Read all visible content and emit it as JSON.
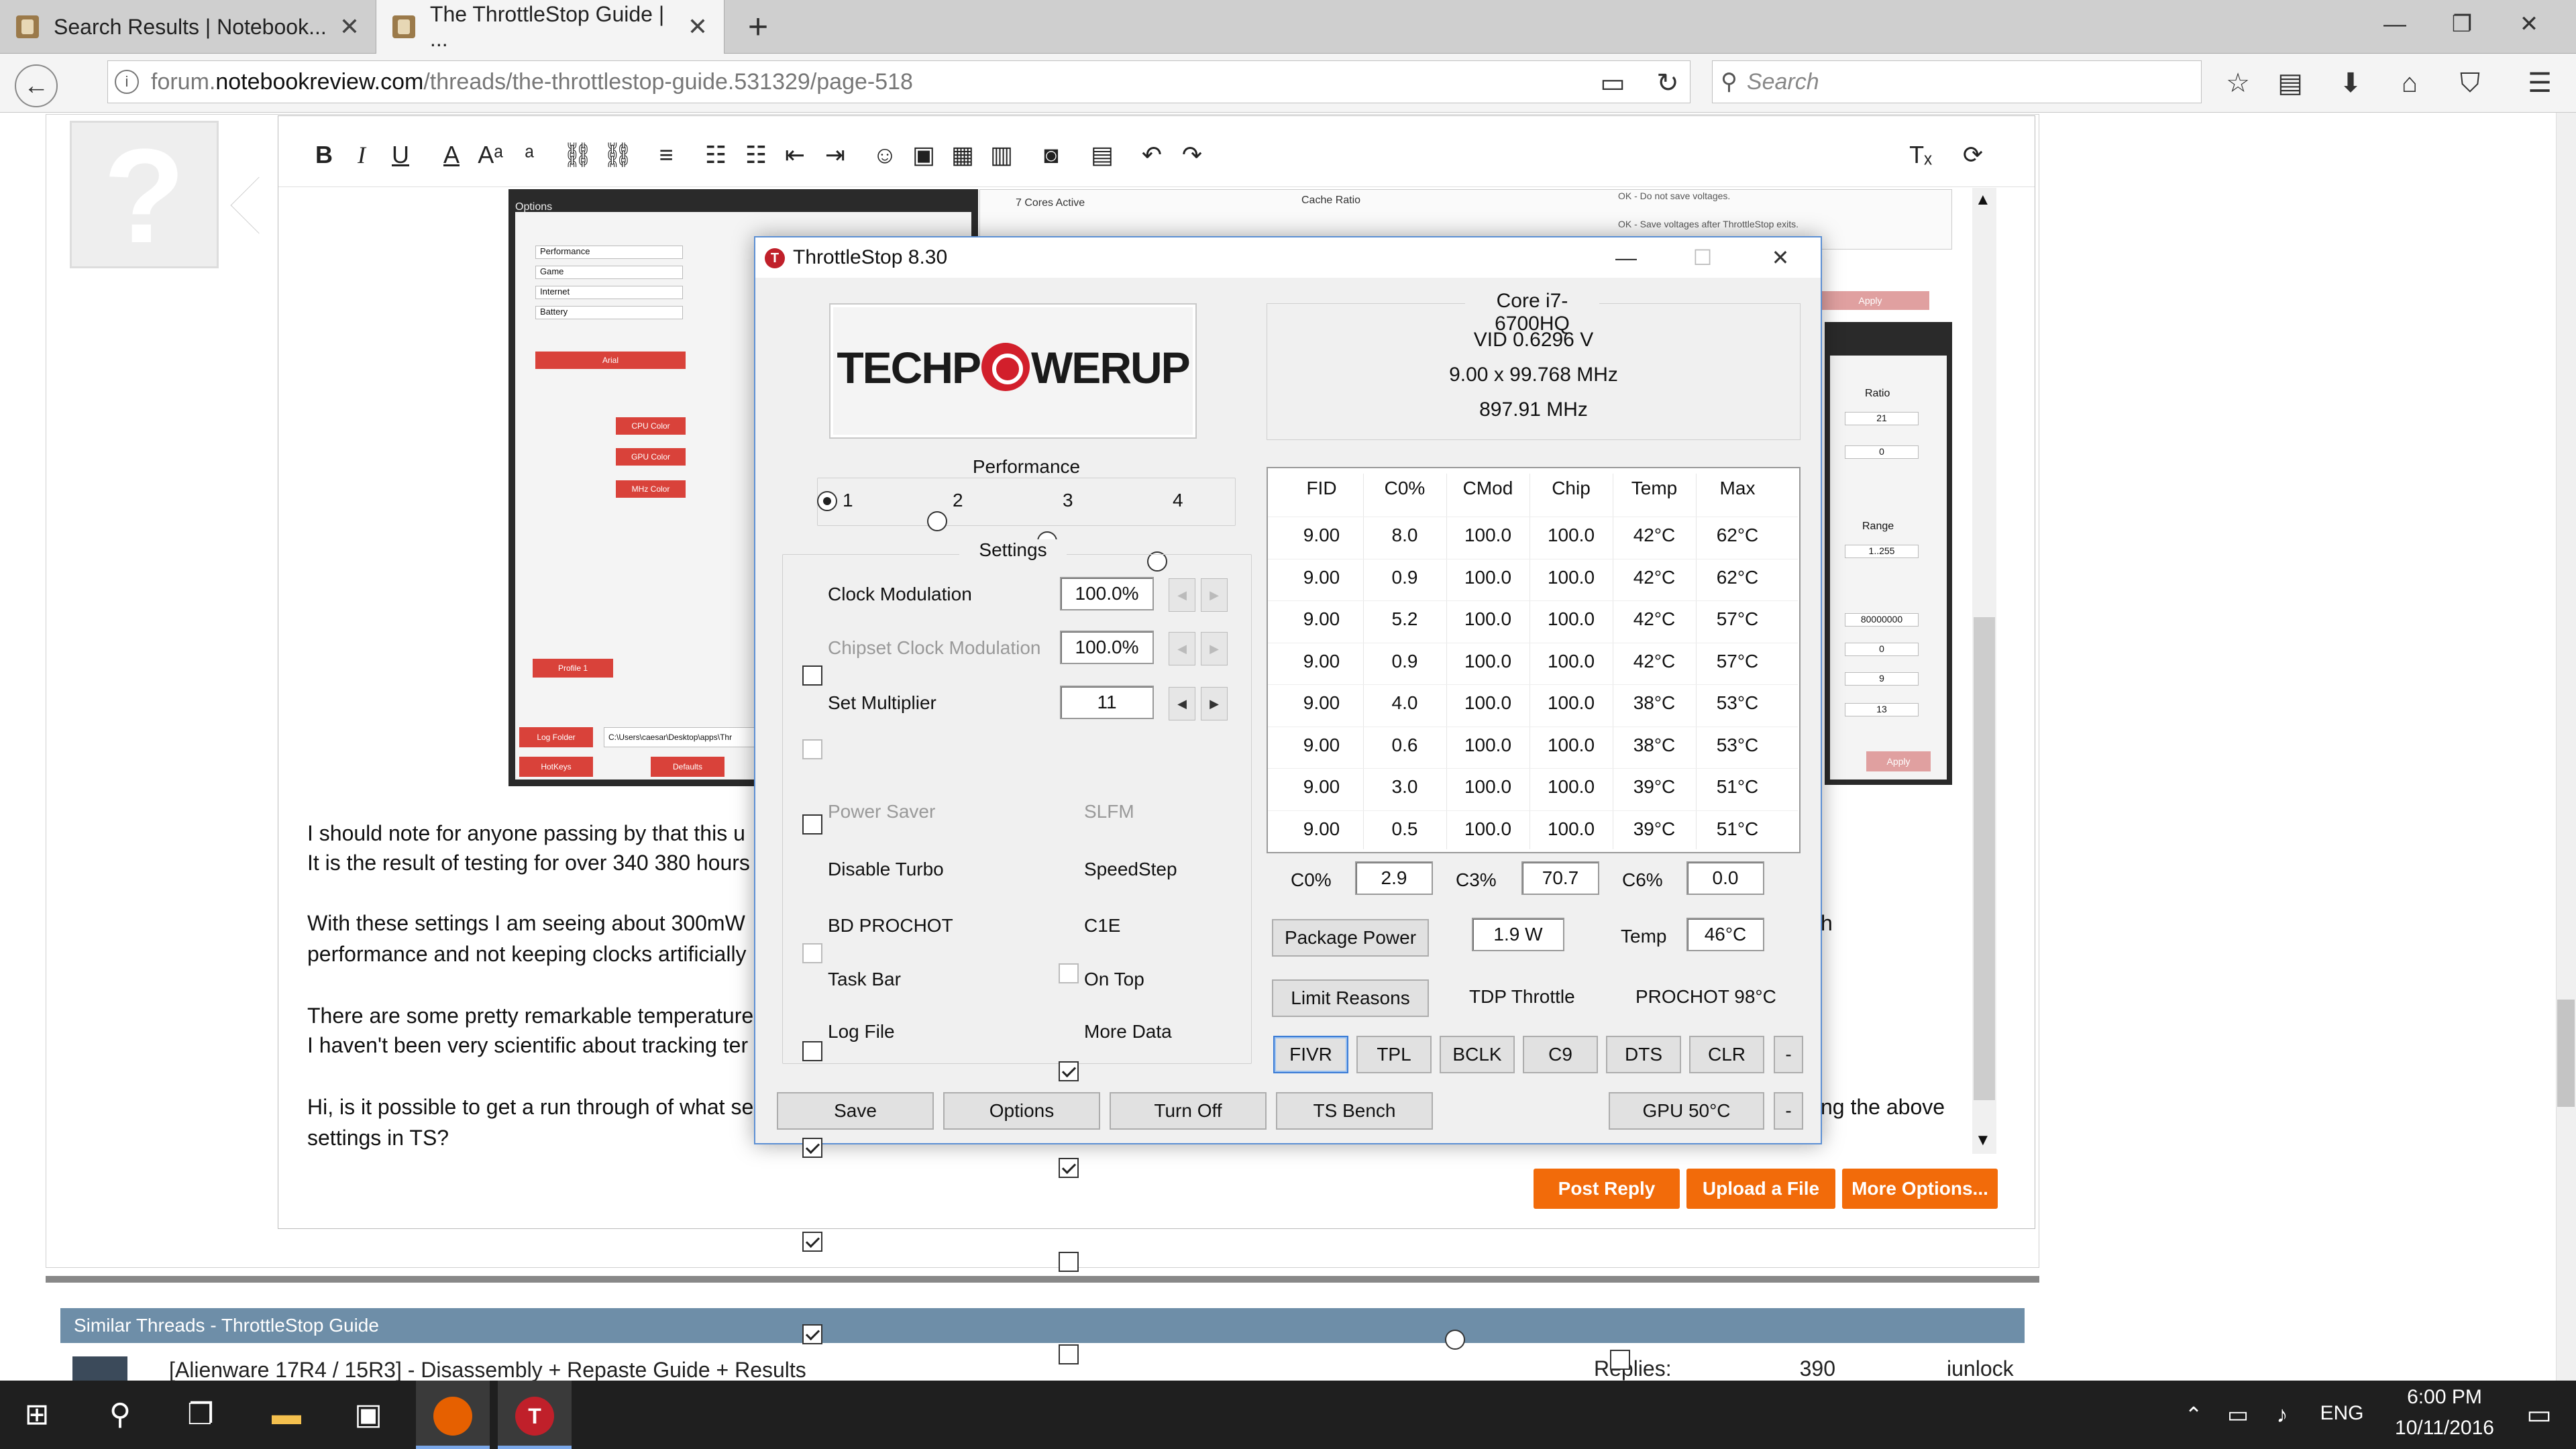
{
  "browser": {
    "tabs": [
      {
        "label": "Search Results | Notebook..."
      },
      {
        "label": "The ThrottleStop Guide | ..."
      }
    ],
    "url_prefix": "forum.",
    "url_host": "notebookreview.com",
    "url_path": "/threads/the-throttlestop-guide.531329/page-518",
    "search_placeholder": "Search",
    "new_tab": "+"
  },
  "post": {
    "lines": [
      "I should note for anyone passing by that this u",
      "It is the result of testing for over 340 380 hours",
      "With these settings I am seeing about 300mW",
      "performance and not keeping clocks artificially",
      "There are some pretty remarkable temperature",
      "I haven't been very scientific about tracking ter",
      "Hi, is it possible to get a run through of what se",
      "settings in TS?"
    ],
    "right_fragments": {
      "h": "h",
      "above": "ng the above"
    },
    "embedded": {
      "cores_active": "7 Cores Active",
      "cache_ratio": "Cache Ratio",
      "ok1": "OK - Do not save voltages.",
      "ok2": "OK - Save voltages after ThrottleStop exits.",
      "apply": "Apply",
      "ratio": "Ratio",
      "ratio_vals": [
        "21",
        "0"
      ],
      "range": "Range",
      "range_val": "1..255",
      "hex_vals": [
        "80000000",
        "0",
        "9",
        "13"
      ],
      "options_title": "Options",
      "profile_names": [
        "Performance",
        "Game",
        "Internet",
        "Battery"
      ],
      "log_folder": "Log Folder",
      "log_path": "C:\\Users\\caesar\\Desktop\\apps\\Thr",
      "hotkeys": "HotKeys",
      "defaults": "Defaults",
      "profile1": "Profile 1",
      "arial": "Arial",
      "cpu_color": "CPU Color",
      "gpu_color": "GPU Color",
      "mhz_color": "MHz Color"
    },
    "buttons": {
      "post_reply": "Post Reply",
      "upload": "Upload a File",
      "more": "More Options..."
    }
  },
  "similar": {
    "header": "Similar Threads - ThrottleStop Guide",
    "title": "[Alienware 17R4 / 15R3] - Disassembly + Repaste Guide + Results",
    "replies_label": "Replies:",
    "replies": "390",
    "author": "iunlock"
  },
  "throttlestop": {
    "title": "ThrottleStop 8.30",
    "logo_left": "TECHP",
    "logo_right": "WERUP",
    "cpu": "Core i7-6700HQ",
    "vid": "VID  0.6296 V",
    "multiplier": "9.00 x 99.768 MHz",
    "freq": "897.91 MHz",
    "performance_label": "Performance",
    "profiles": [
      "1",
      "2",
      "3",
      "4"
    ],
    "selected_profile": 1,
    "settings_label": "Settings",
    "clock_mod": {
      "label": "Clock Modulation",
      "value": "100.0%"
    },
    "chipset_mod": {
      "label": "Chipset Clock Modulation",
      "value": "100.0%"
    },
    "set_mult": {
      "label": "Set Multiplier",
      "value": "11"
    },
    "options_left": [
      "Power Saver",
      "Disable Turbo",
      "BD PROCHOT",
      "Task Bar",
      "Log File"
    ],
    "options_right": [
      "SLFM",
      "SpeedStep",
      "C1E",
      "On Top",
      "More Data"
    ],
    "table": {
      "headers": [
        "FID",
        "C0%",
        "CMod",
        "Chip",
        "Temp",
        "Max"
      ],
      "rows": [
        [
          "9.00",
          "8.0",
          "100.0",
          "100.0",
          "42°C",
          "62°C"
        ],
        [
          "9.00",
          "0.9",
          "100.0",
          "100.0",
          "42°C",
          "62°C"
        ],
        [
          "9.00",
          "5.2",
          "100.0",
          "100.0",
          "42°C",
          "57°C"
        ],
        [
          "9.00",
          "0.9",
          "100.0",
          "100.0",
          "42°C",
          "57°C"
        ],
        [
          "9.00",
          "4.0",
          "100.0",
          "100.0",
          "38°C",
          "53°C"
        ],
        [
          "9.00",
          "0.6",
          "100.0",
          "100.0",
          "38°C",
          "53°C"
        ],
        [
          "9.00",
          "3.0",
          "100.0",
          "100.0",
          "39°C",
          "51°C"
        ],
        [
          "9.00",
          "0.5",
          "100.0",
          "100.0",
          "39°C",
          "51°C"
        ]
      ]
    },
    "c0_label": "C0%",
    "c0": "2.9",
    "c3_label": "C3%",
    "c3": "70.7",
    "c6_label": "C6%",
    "c6": "0.0",
    "package_power": "Package Power",
    "package_power_val": "1.9 W",
    "temp_label": "Temp",
    "temp_val": "46°C",
    "limit_reasons": "Limit Reasons",
    "tdp_throttle": "TDP Throttle",
    "prochot": "PROCHOT 98°C",
    "row_buttons": [
      "FIVR",
      "TPL",
      "BCLK",
      "C9",
      "DTS",
      "CLR",
      "-"
    ],
    "bottom_buttons": [
      "Save",
      "Options",
      "Turn Off",
      "TS Bench"
    ],
    "gpu": "GPU 50°C",
    "gpu_extra": "-"
  },
  "taskbar": {
    "lang": "ENG",
    "time": "6:00 PM",
    "date": "10/11/2016"
  }
}
